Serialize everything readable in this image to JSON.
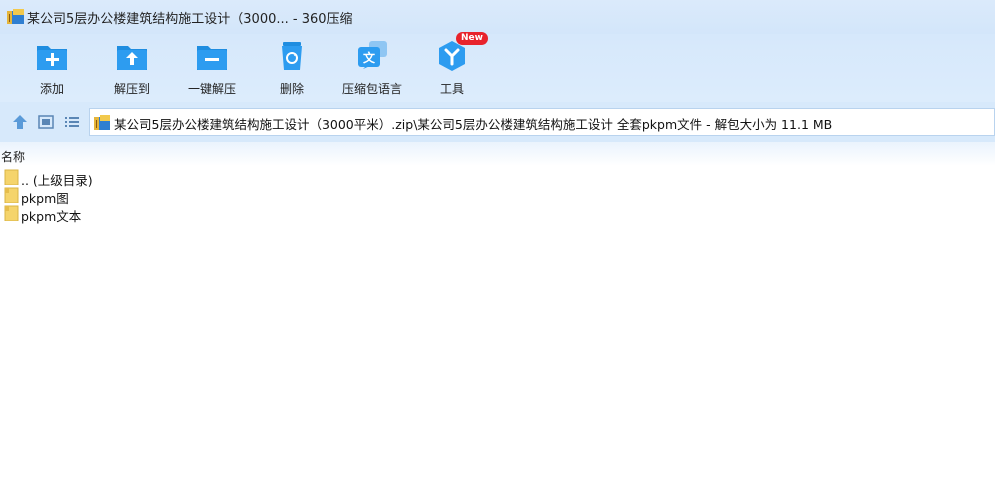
{
  "window": {
    "title": "某公司5层办公楼建筑结构施工设计（3000... - 360压缩"
  },
  "toolbar": {
    "items": [
      {
        "label": "添加",
        "icon": "add-folder-icon"
      },
      {
        "label": "解压到",
        "icon": "extract-to-icon"
      },
      {
        "label": "一键解压",
        "icon": "one-click-extract-icon"
      },
      {
        "label": "删除",
        "icon": "recycle-bin-icon"
      },
      {
        "label": "压缩包语言",
        "icon": "archive-language-icon"
      },
      {
        "label": "工具",
        "icon": "tools-icon",
        "badge": "New"
      }
    ]
  },
  "address": {
    "path": "某公司5层办公楼建筑结构施工设计（3000平米）.zip\\某公司5层办公楼建筑结构施工设计 全套pkpm文件 - 解包大小为 11.1 MB"
  },
  "list": {
    "column_name": "名称",
    "rows": [
      {
        "name": ".. (上级目录)",
        "type": "parent-folder"
      },
      {
        "name": "pkpm图",
        "type": "folder"
      },
      {
        "name": "pkpm文本",
        "type": "folder"
      }
    ]
  },
  "colors": {
    "accent": "#1e8fe0",
    "toolbar_bg": "#d6e8fb",
    "badge": "#e8232c",
    "folder": "#f5d46b"
  }
}
